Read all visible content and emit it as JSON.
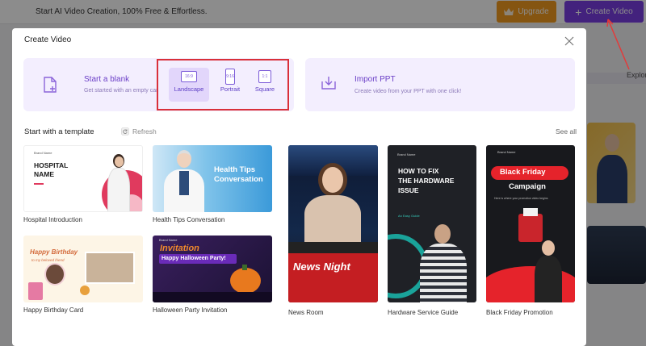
{
  "app": {
    "tagline": "Start AI Video Creation, 100% Free & Effortless.",
    "upgrade_label": "Upgrade",
    "create_label": "Create Video",
    "explore_label": "Explor",
    "accent_color": "#7b3fe4",
    "upgrade_color": "#f39c1f"
  },
  "modal": {
    "title": "Create Video",
    "blank": {
      "title": "Start a blank",
      "subtitle": "Get started with an empty canvas"
    },
    "aspects": [
      {
        "label": "Landscape",
        "ratio": "16:9",
        "selected": true
      },
      {
        "label": "Portrait",
        "ratio": "9:16",
        "selected": false
      },
      {
        "label": "Square",
        "ratio": "1:1",
        "selected": false
      }
    ],
    "import": {
      "title": "Import PPT",
      "subtitle": "Create video from your PPT with one click!"
    },
    "templates_title": "Start with a template",
    "refresh_label": "Refresh",
    "see_all_label": "See all",
    "templates": [
      {
        "name": "Hospital Introduction",
        "thumb_text": [
          "HOSPITAL",
          "NAME"
        ],
        "thumb_sub": "Brand Name"
      },
      {
        "name": "Health Tips Conversation",
        "thumb_text": [
          "Health Tips",
          "Conversation"
        ]
      },
      {
        "name": "News Room",
        "thumb_text": [
          "News Night"
        ]
      },
      {
        "name": "Hardware Service Guide",
        "thumb_text": [
          "HOW TO FIX",
          "THE HARDWARE",
          "ISSUE"
        ],
        "thumb_sub": "An Easy Guide",
        "thumb_brand": "Brand Name"
      },
      {
        "name": "Black Friday Promotion",
        "thumb_text": [
          "Black Friday",
          "Campaign"
        ],
        "thumb_sub": "Here is where your promotion video begins",
        "thumb_brand": "Brand Name"
      },
      {
        "name": "Happy Birthday Card",
        "thumb_text": [
          "Happy Birthday",
          "to my beloved friend"
        ]
      },
      {
        "name": "Halloween Party Invitation",
        "thumb_text": [
          "Invitation",
          "Happy Halloween Party!"
        ],
        "thumb_brand": "Brand Name"
      }
    ]
  }
}
